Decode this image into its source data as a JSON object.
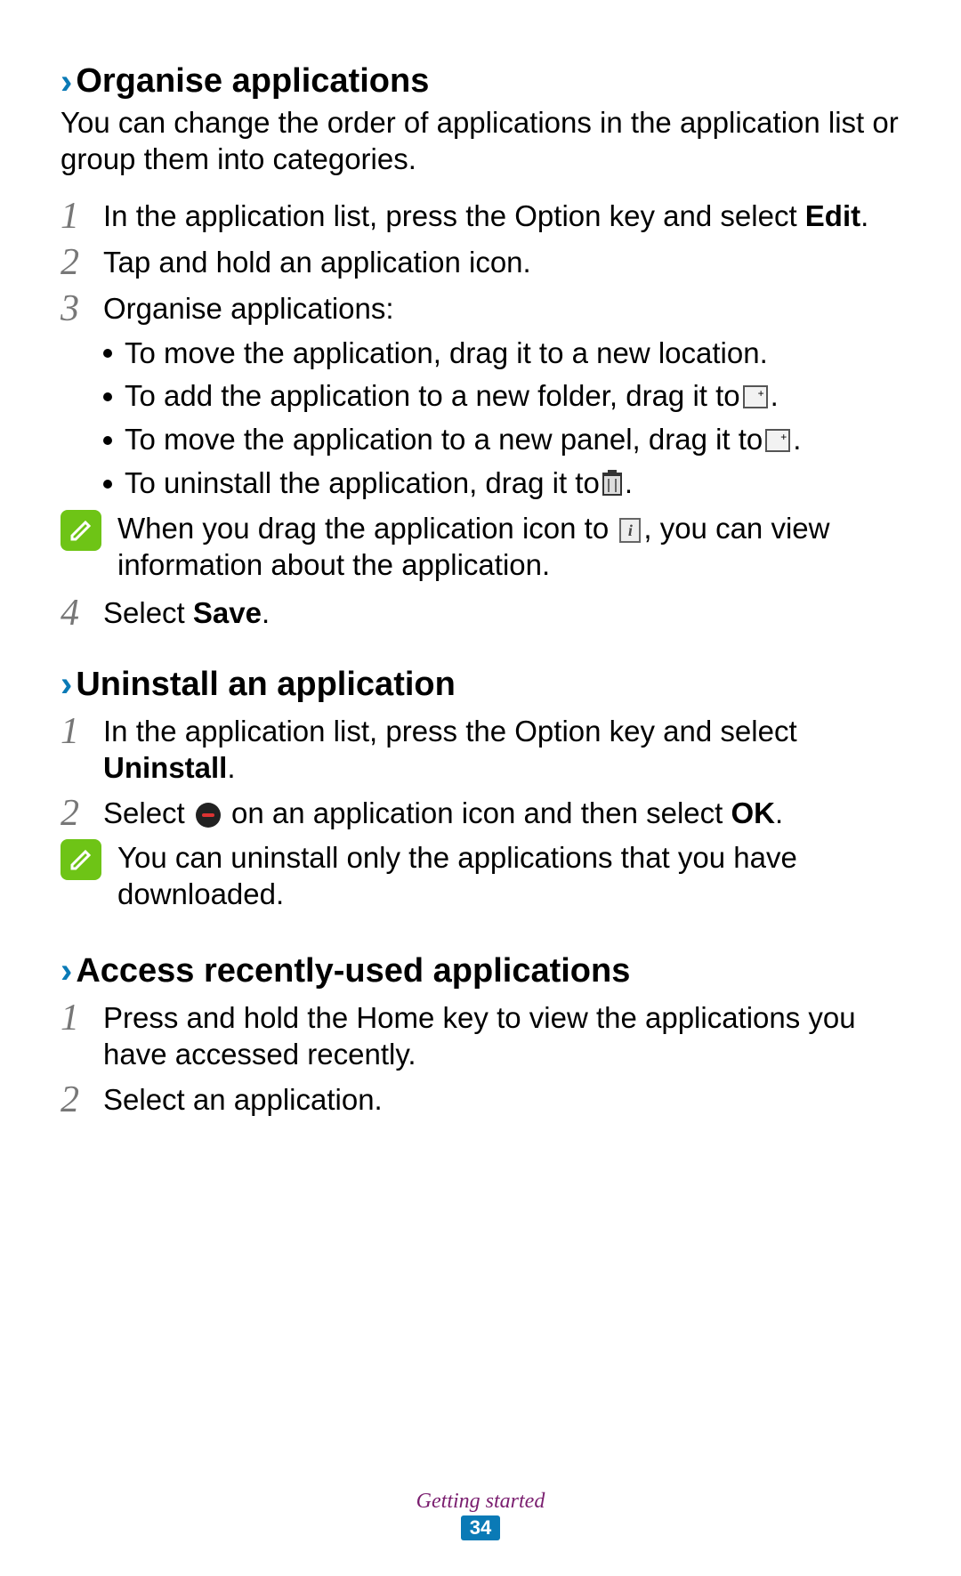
{
  "sections": {
    "organise": {
      "heading": "Organise applications",
      "intro": "You can change the order of applications in the application list or group them into categories.",
      "step1_pre": "In the application list, press the Option key and select ",
      "step1_bold": "Edit",
      "step1_post": ".",
      "step2": "Tap and hold an application icon.",
      "step3_intro": "Organise applications:",
      "bullet1": "To move the application, drag it to a new location.",
      "bullet2_pre": "To add the application to a new folder, drag it to ",
      "bullet2_post": ".",
      "bullet3_pre": "To move the application to a new panel, drag it to ",
      "bullet3_post": ".",
      "bullet4_pre": "To uninstall the application, drag it to ",
      "bullet4_post": ".",
      "note_pre": "When you drag the application icon to ",
      "note_post": ", you can view information about the application.",
      "step4_pre": "Select ",
      "step4_bold": "Save",
      "step4_post": "."
    },
    "uninstall": {
      "heading": "Uninstall an application",
      "step1_pre": "In the application list, press the Option key and select ",
      "step1_bold": "Uninstall",
      "step1_post": ".",
      "step2_pre": "Select ",
      "step2_mid": " on an application icon and then select ",
      "step2_bold": "OK",
      "step2_post": ".",
      "note": "You can uninstall only the applications that you have downloaded."
    },
    "recent": {
      "heading": "Access recently-used applications",
      "step1": "Press and hold the Home key to view the applications you have accessed recently.",
      "step2": "Select an application."
    }
  },
  "footer": {
    "label": "Getting started",
    "page": "34"
  },
  "icons": {
    "chevron": "›",
    "folder_plus": "+",
    "panel_plus": "+",
    "info_letter": "i"
  }
}
